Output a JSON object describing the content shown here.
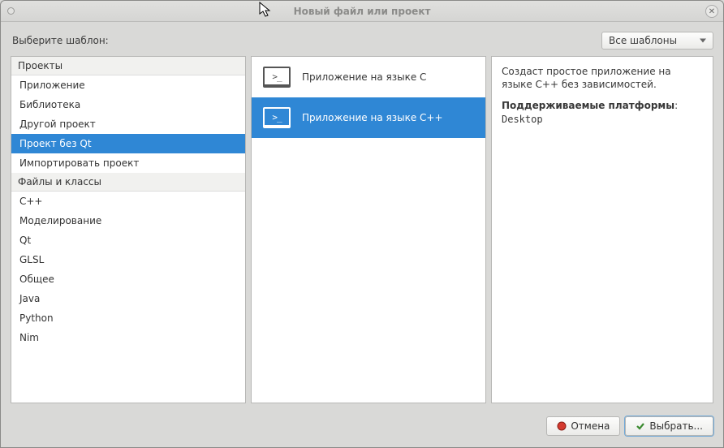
{
  "window": {
    "title": "Новый файл или проект"
  },
  "toprow": {
    "choose_label": "Выберите шаблон:",
    "filter_value": "Все шаблоны"
  },
  "categories": {
    "group1": {
      "header": "Проекты",
      "items": [
        {
          "label": "Приложение",
          "selected": false
        },
        {
          "label": "Библиотека",
          "selected": false
        },
        {
          "label": "Другой проект",
          "selected": false
        },
        {
          "label": "Проект без Qt",
          "selected": true
        },
        {
          "label": "Импортировать проект",
          "selected": false
        }
      ]
    },
    "group2": {
      "header": "Файлы и классы",
      "items": [
        {
          "label": "C++",
          "selected": false
        },
        {
          "label": "Моделирование",
          "selected": false
        },
        {
          "label": "Qt",
          "selected": false
        },
        {
          "label": "GLSL",
          "selected": false
        },
        {
          "label": "Общее",
          "selected": false
        },
        {
          "label": "Java",
          "selected": false
        },
        {
          "label": "Python",
          "selected": false
        },
        {
          "label": "Nim",
          "selected": false
        }
      ]
    }
  },
  "templates": [
    {
      "label": "Приложение на языке C",
      "selected": false
    },
    {
      "label": "Приложение на языке C++",
      "selected": true
    }
  ],
  "description": {
    "line1": "Создаст простое приложение на языке C++ без зависимостей.",
    "platforms_label": "Поддерживаемые платформы",
    "platforms_value": "Desktop"
  },
  "buttons": {
    "cancel": "Отмена",
    "choose": "Выбрать..."
  }
}
